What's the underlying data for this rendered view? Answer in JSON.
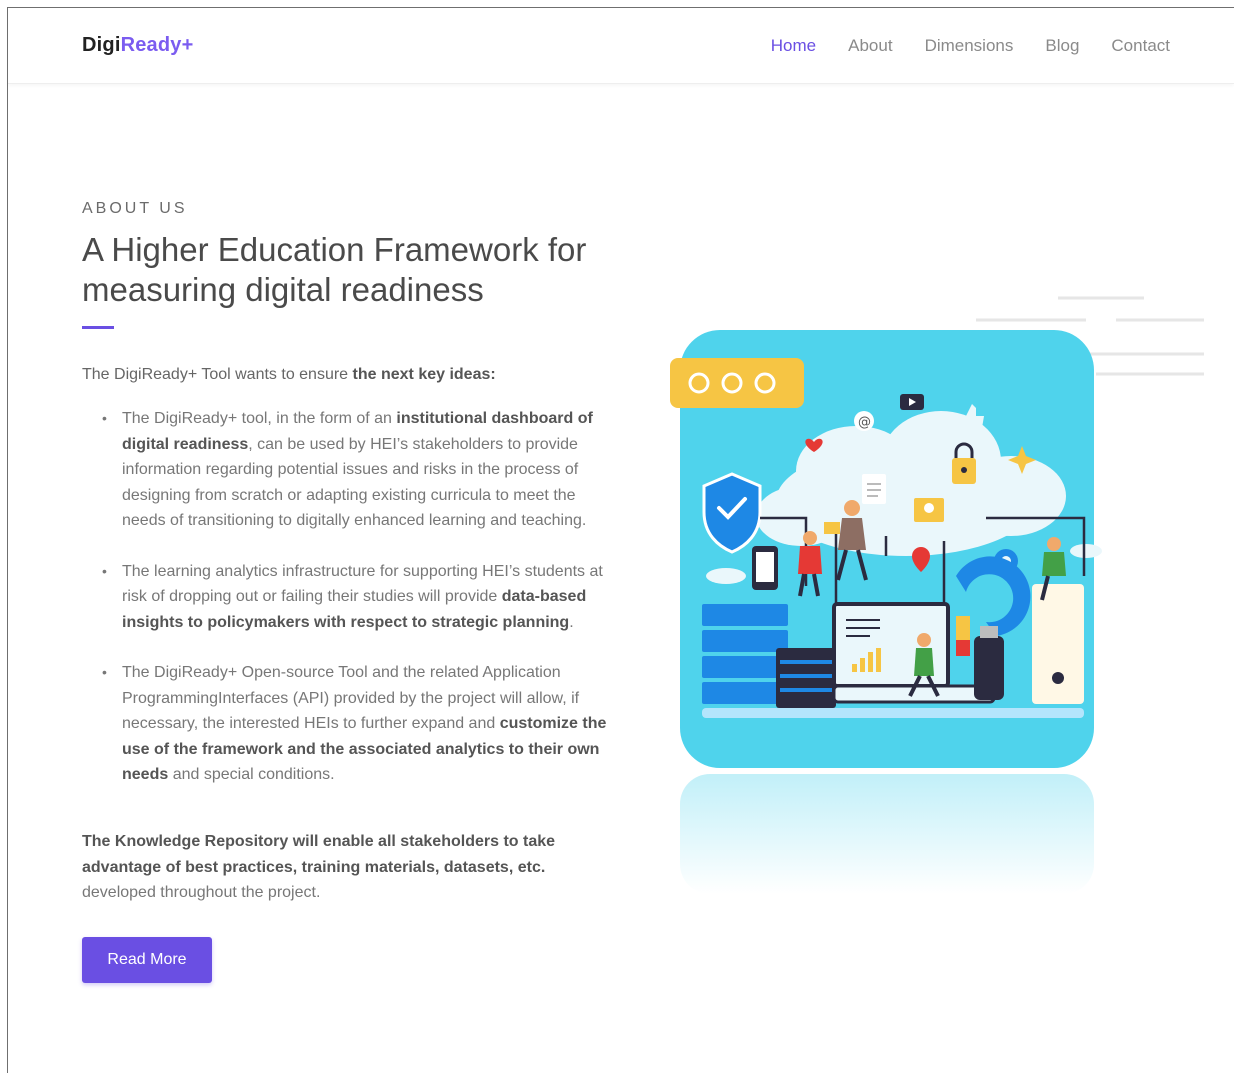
{
  "header": {
    "logo_part1": "Digi",
    "logo_part2": "Ready+",
    "nav": [
      {
        "label": "Home",
        "active": true
      },
      {
        "label": "About",
        "active": false
      },
      {
        "label": "Dimensions",
        "active": false
      },
      {
        "label": "Blog",
        "active": false
      },
      {
        "label": "Contact",
        "active": false
      }
    ]
  },
  "about": {
    "eyebrow": "ABOUT US",
    "headline": "A Higher Education Framework for measuring digital readiness",
    "intro_plain": "The DigiReady+ Tool wants to ensure ",
    "intro_bold": "the next key ideas:",
    "ideas": [
      {
        "p1": "The DigiReady+ tool, in the form of an ",
        "b1": "institutional dashboard of digital readiness",
        "p2": ", can be used by HEI’s stakeholders to provide information regarding potential issues and risks in the process of designing from scratch or adapting existing curricula to meet the needs of transitioning to digitally enhanced learning and teaching."
      },
      {
        "p1": "The learning analytics infrastructure for supporting HEI’s students at risk of dropping out or failing their studies will provide ",
        "b1": "data-based insights to policymakers with respect to strategic planning",
        "p2": "."
      },
      {
        "p1": "The DigiReady+ Open-source Tool and the related Application ProgrammingInterfaces (API) provided by the project will allow, if necessary, the interested HEIs to further expand and ",
        "b1": "customize the use of the framework and the associated analytics to their own needs",
        "p2": " and special conditions."
      }
    ],
    "closing_bold": "The Knowledge Repository will enable all stakeholders to take advantage of best practices, training materials, datasets, etc.",
    "closing_plain": " developed throughout the project.",
    "button_label": "Read More"
  },
  "colors": {
    "accent": "#6a4fe3",
    "illustration_bg": "#4fd3ec",
    "window_bar": "#f6c544"
  }
}
